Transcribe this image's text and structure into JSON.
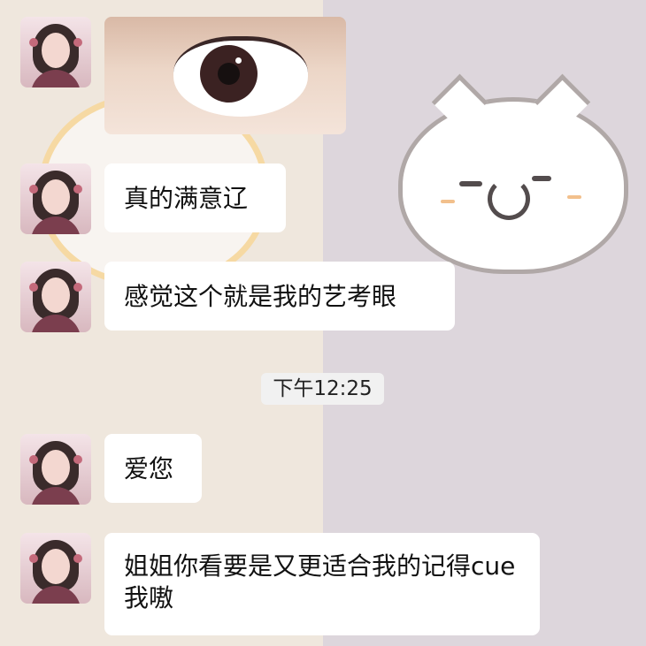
{
  "chat": {
    "messages": [
      {
        "type": "image",
        "content": "eye-photo"
      },
      {
        "type": "text",
        "text": "真的满意辽"
      },
      {
        "type": "text",
        "text": "感觉这个就是我的艺考眼"
      },
      {
        "type": "time",
        "text": "下午12:25"
      },
      {
        "type": "text",
        "text": "爱您"
      },
      {
        "type": "text",
        "text": "姐姐你看要是又更适合我的记得cue我嗷"
      }
    ]
  },
  "colors": {
    "left_background": "#efe7dd",
    "right_background": "#ddd6dc",
    "bubble": "#ffffff"
  }
}
